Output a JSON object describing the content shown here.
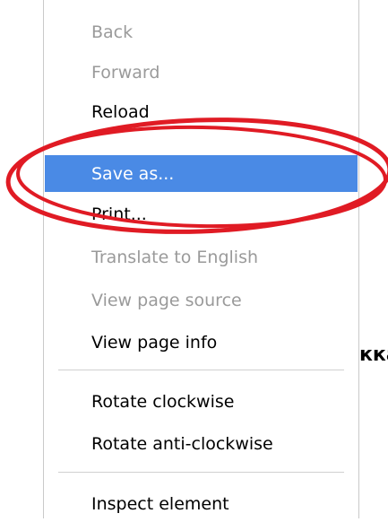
{
  "context_menu": {
    "items": [
      {
        "label": "Back",
        "enabled": false
      },
      {
        "label": "Forward",
        "enabled": false
      },
      {
        "label": "Reload",
        "enabled": true
      },
      {
        "label": "Save as...",
        "enabled": true,
        "selected": true
      },
      {
        "label": "Print...",
        "enabled": true
      },
      {
        "label": "Translate to English",
        "enabled": false
      },
      {
        "label": "View page source",
        "enabled": false
      },
      {
        "label": "View page info",
        "enabled": true
      },
      {
        "label": "Rotate clockwise",
        "enabled": true
      },
      {
        "label": "Rotate anti-clockwise",
        "enabled": true
      },
      {
        "label": "Inspect element",
        "enabled": true
      }
    ]
  },
  "background_page": {
    "text_fragment": "кка"
  },
  "annotation": {
    "color": "#e01b24"
  },
  "colors": {
    "selected_background": "#4a8ae5",
    "disabled_text": "#9a9a9a"
  }
}
